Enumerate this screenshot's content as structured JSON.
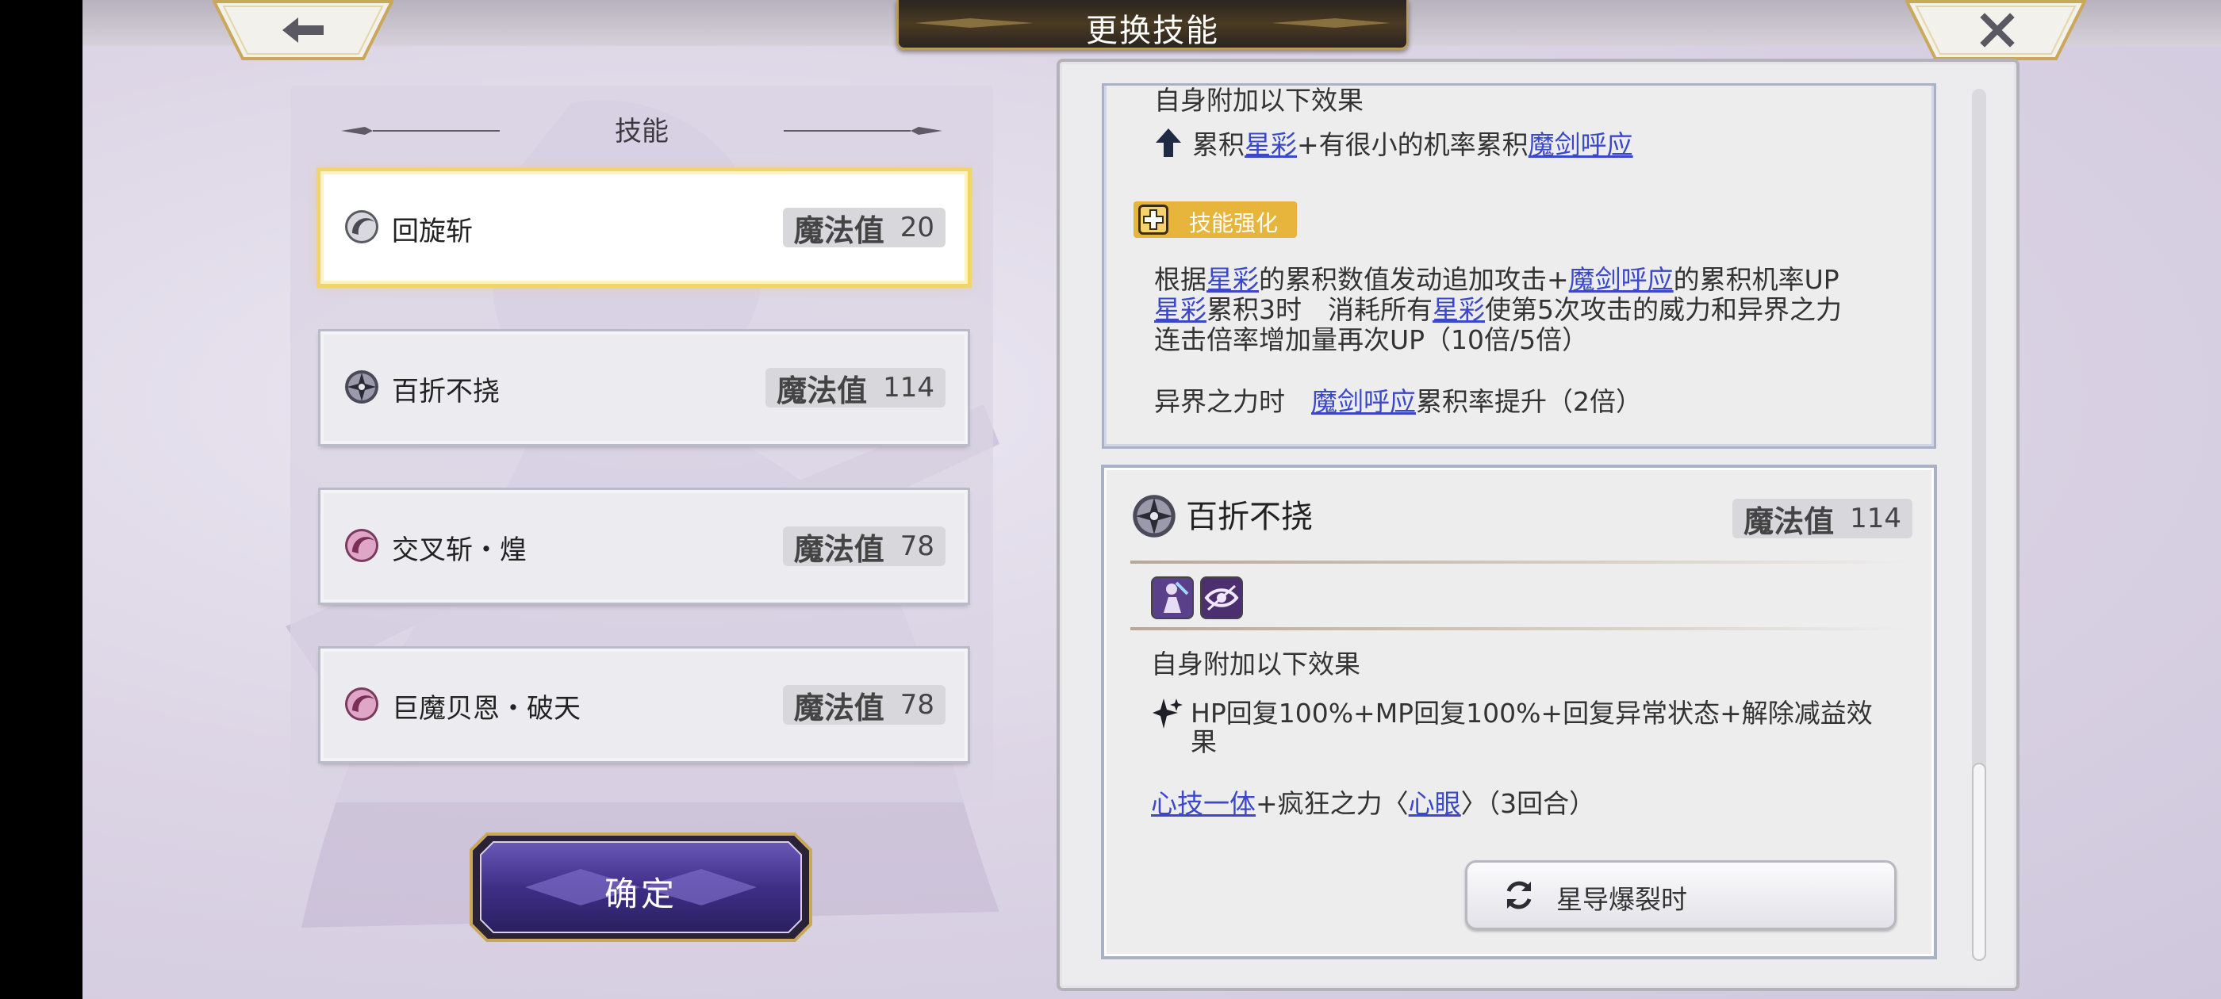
{
  "header": {
    "title": "更换技能"
  },
  "skill_list": {
    "heading": "技能",
    "items": [
      {
        "name": "回旋斩",
        "mp_label": "魔法值",
        "mp": "20",
        "selected": true
      },
      {
        "name": "百折不挠",
        "mp_label": "魔法值",
        "mp": "114",
        "selected": false
      },
      {
        "name": "交叉斩・煌",
        "mp_label": "魔法值",
        "mp": "78",
        "selected": false
      },
      {
        "name": "巨魔贝恩・破天",
        "mp_label": "魔法值",
        "mp": "78",
        "selected": false
      }
    ],
    "confirm_label": "确定"
  },
  "detail_top": {
    "self_effect": "自身附加以下效果",
    "line1_a": "累积",
    "line1_link1": "星彩",
    "line1_b": "+有很小的机率累积",
    "line1_link2": "魔剑呼应",
    "enhance_badge": "技能强化",
    "p1_a": "根据",
    "p1_link1": "星彩",
    "p1_b": "的累积数值发动追加攻击+",
    "p1_link2": "魔剑呼应",
    "p1_c": "的累积机率UP",
    "p2_link1": "星彩",
    "p2_a": "累积3时　消耗所有",
    "p2_link2": "星彩",
    "p2_b": "使第5次攻击的威力和异界之力",
    "p3": "连击倍率增加量再次UP（10倍/5倍）",
    "p4_a": "异界之力时　",
    "p4_link": "魔剑呼应",
    "p4_b": "累积率提升（2倍）"
  },
  "detail_bottom": {
    "skill_name": "百折不挠",
    "mp_label": "魔法值",
    "mp": "114",
    "self_effect": "自身附加以下效果",
    "effect_line1": "HP回复100%+MP回复100%+回复异常状态+解除减益效",
    "effect_line2": "果",
    "buff_link1": "心技一体",
    "buff_a": "+疯狂之力〈",
    "buff_link2": "心眼",
    "buff_b": "〉（3回合）",
    "trigger_button": "星导爆裂时"
  },
  "colors": {
    "link": "#3a48c9",
    "selected_border": "#f2d46a",
    "enhance_badge": "#e7b43c",
    "title_plate": "#2a2520"
  }
}
